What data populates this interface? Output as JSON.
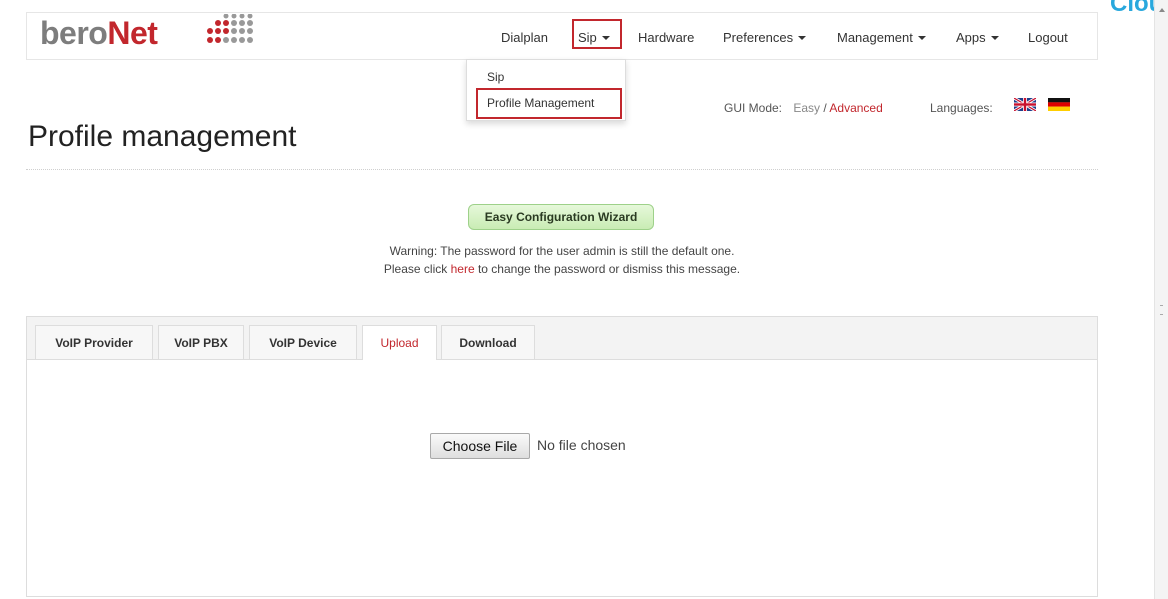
{
  "brand": {
    "part1": "bero",
    "part2": "Net"
  },
  "corner_text": "Cloud",
  "nav": {
    "items": [
      {
        "label": "Dialplan",
        "dropdown": false
      },
      {
        "label": "Sip",
        "dropdown": true
      },
      {
        "label": "Hardware",
        "dropdown": false
      },
      {
        "label": "Preferences",
        "dropdown": true
      },
      {
        "label": "Management",
        "dropdown": true
      },
      {
        "label": "Apps",
        "dropdown": true
      },
      {
        "label": "Logout",
        "dropdown": false
      }
    ]
  },
  "sip_menu": {
    "items": [
      "Sip",
      "Profile Management"
    ]
  },
  "gui_mode": {
    "label": "GUI Mode:",
    "easy": "Easy",
    "separator": " / ",
    "advanced": "Advanced"
  },
  "languages": {
    "label": "Languages:",
    "flags": [
      "uk-flag-icon",
      "germany-flag-icon"
    ]
  },
  "page_title": "Profile management",
  "wizard_button": "Easy Configuration Wizard",
  "warning": {
    "line1": "Warning: The password for the user admin is still the default one.",
    "line2_before": "Please click ",
    "line2_link": "here",
    "line2_after": " to change the password or dismiss this message."
  },
  "tabs": [
    {
      "label": "VoIP Provider",
      "active": false
    },
    {
      "label": "VoIP PBX",
      "active": false
    },
    {
      "label": "VoIP Device",
      "active": false
    },
    {
      "label": "Upload",
      "active": true
    },
    {
      "label": "Download",
      "active": false
    }
  ],
  "upload": {
    "button_label": "Choose File",
    "status": "No file chosen"
  },
  "colors": {
    "accent": "#c2272d",
    "brand_gray": "#7d7d7d",
    "wizard_green": "#c9ecb4",
    "corner": "#29a8dd"
  }
}
